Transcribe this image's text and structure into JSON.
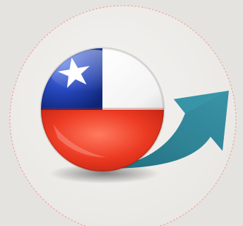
{
  "illustration": {
    "background_color": "#e5e3df",
    "disc_color": "#efeeec",
    "disc_border_color": "#f0a59b",
    "globe_icon": "chile-flag-sphere-icon",
    "arrow_icon": "growth-arrow-icon",
    "colors": {
      "flag_blue": "#1f3fae",
      "flag_white": "#ffffff",
      "flag_red": "#e8311f",
      "arrow_teal": "#2f8496"
    }
  }
}
